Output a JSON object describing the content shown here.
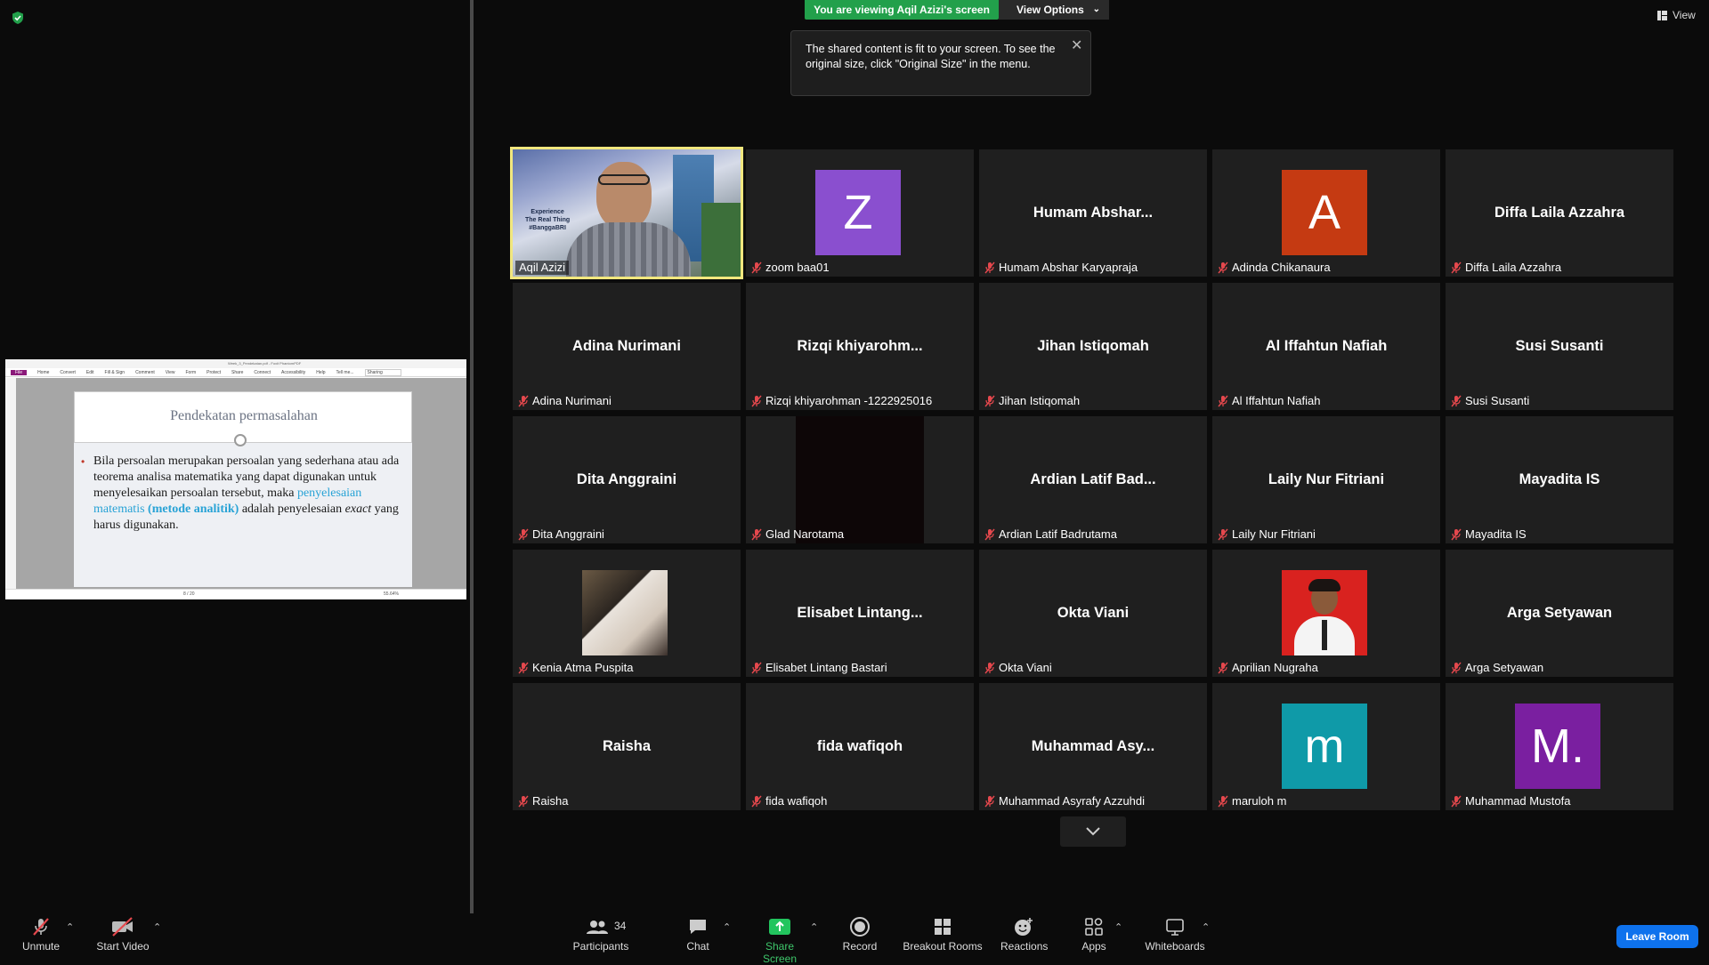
{
  "banner": {
    "viewing": "You are viewing Aqil Azizi's screen",
    "view_options": "View Options"
  },
  "tooltip": {
    "text": "The shared content is fit to your screen. To see the original size, click \"Original Size\" in the menu."
  },
  "view_button": "View",
  "shared_screen": {
    "title_bar": "Week_3_Pendekatan.pdf - Foxit PhantomPDF",
    "menu": [
      "File",
      "Home",
      "Convert",
      "Edit",
      "Fill & Sign",
      "Comment",
      "View",
      "Form",
      "Protect",
      "Share",
      "Connect",
      "Accessibility",
      "Help",
      "Tell me..."
    ],
    "search": "Sharing",
    "slide_title": "Pendekatan permasalahan",
    "slide_text_1": "Bila persoalan merupakan persoalan yang sederhana atau ada teorema analisa matematika yang dapat digunakan untuk menyelesaikan persoalan tersebut, maka ",
    "slide_text_hl": "penyelesaian matematis",
    "slide_text_hlb": "(metode analitik)",
    "slide_text_2": " adalah penyelesaian ",
    "slide_text_em": "exact",
    "slide_text_3": " yang harus digunakan.",
    "page_indicator": "8 / 20",
    "zoom": "55.64%"
  },
  "participants": [
    {
      "label": "Aqil Azizi",
      "display": "",
      "type": "video",
      "active": true
    },
    {
      "label": "zoom baa01",
      "display": "Z",
      "type": "avatar",
      "color": "#8a4fcf"
    },
    {
      "label": "Humam Abshar Karyapraja",
      "display": "Humam  Abshar...",
      "type": "name"
    },
    {
      "label": "Adinda Chikanaura",
      "display": "A",
      "type": "avatar",
      "color": "#c53a12"
    },
    {
      "label": "Diffa Laila Azzahra",
      "display": "Diffa Laila Azzahra",
      "type": "name"
    },
    {
      "label": "Adina Nurimani",
      "display": "Adina Nurimani",
      "type": "name"
    },
    {
      "label": "Rizqi khiyarohman -1222925016",
      "display": "Rizqi  khiyarohm...",
      "type": "name"
    },
    {
      "label": "Jihan Istiqomah",
      "display": "Jihan Istiqomah",
      "type": "name"
    },
    {
      "label": "Al Iffahtun Nafiah",
      "display": "Al Iffahtun Nafiah",
      "type": "name"
    },
    {
      "label": "Susi Susanti",
      "display": "Susi Susanti",
      "type": "name"
    },
    {
      "label": "Dita Anggraini",
      "display": "Dita Anggraini",
      "type": "name"
    },
    {
      "label": "Glad Narotama",
      "display": "",
      "type": "dark"
    },
    {
      "label": "Ardian Latif Badrutama",
      "display": "Ardian  Latif  Bad...",
      "type": "name"
    },
    {
      "label": "Laily Nur Fitriani",
      "display": "Laily Nur Fitriani",
      "type": "name"
    },
    {
      "label": "Mayadita IS",
      "display": "Mayadita IS",
      "type": "name"
    },
    {
      "label": "Kenia Atma Puspita",
      "display": "",
      "type": "photo"
    },
    {
      "label": "Elisabet Lintang Bastari",
      "display": "Elisabet  Lintang...",
      "type": "name"
    },
    {
      "label": "Okta Viani",
      "display": "Okta Viani",
      "type": "name"
    },
    {
      "label": "Aprilian Nugraha",
      "display": "",
      "type": "photo2"
    },
    {
      "label": "Arga Setyawan",
      "display": "Arga Setyawan",
      "type": "name"
    },
    {
      "label": "Raisha",
      "display": "Raisha",
      "type": "name"
    },
    {
      "label": "fida wafiqoh",
      "display": "fida wafiqoh",
      "type": "name"
    },
    {
      "label": "Muhammad Asyrafy Azzuhdi",
      "display": "Muhammad  Asy...",
      "type": "name"
    },
    {
      "label": "maruloh m",
      "display": "m",
      "type": "avatar",
      "color": "#0f9aa8"
    },
    {
      "label": "Muhammad Mustofa",
      "display": "M.",
      "type": "avatar",
      "color": "#7a1fa0"
    }
  ],
  "video_overlay": {
    "line1": "Experience",
    "line2": "The Real Thing",
    "line3": "#BanggaBRI"
  },
  "toolbar": {
    "unmute": "Unmute",
    "start_video": "Start Video",
    "participants": "Participants",
    "participants_count": "34",
    "chat": "Chat",
    "share_screen": "Share Screen",
    "record": "Record",
    "breakout_rooms": "Breakout Rooms",
    "reactions": "Reactions",
    "apps": "Apps",
    "whiteboards": "Whiteboards",
    "leave_room": "Leave Room"
  },
  "colors": {
    "accent_green": "#22a04b",
    "leave_blue": "#0e72ed",
    "active_speaker": "#f1e77e",
    "muted_red": "#e5484d"
  }
}
